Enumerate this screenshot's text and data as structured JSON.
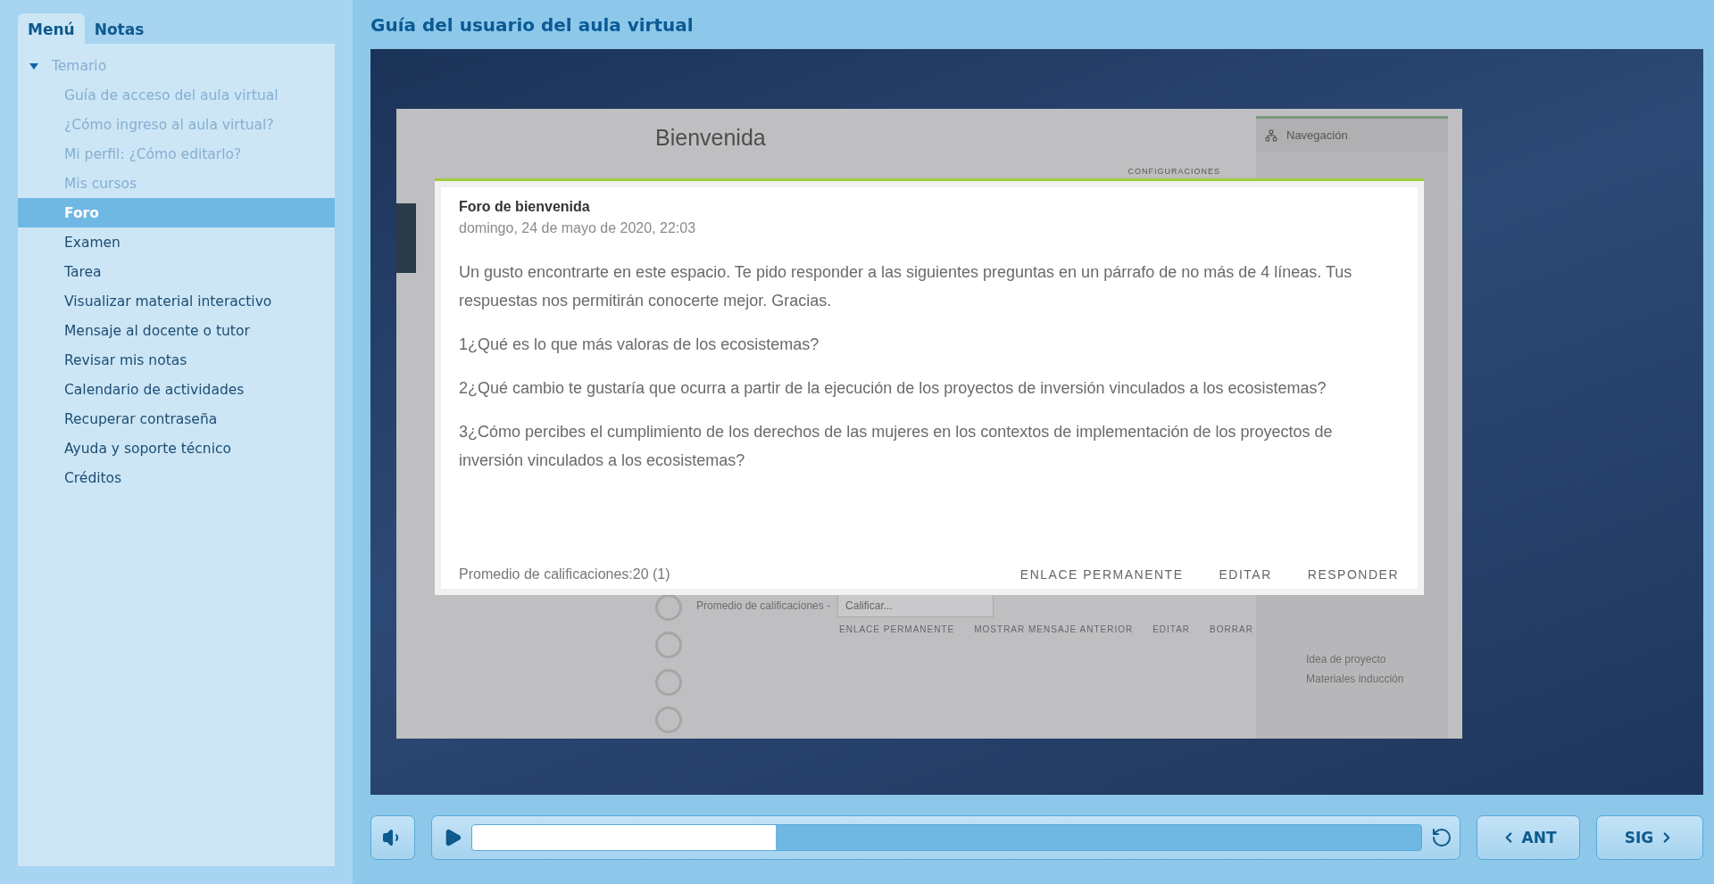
{
  "sidebar": {
    "tabs": [
      {
        "label": "Menú",
        "selected": true
      },
      {
        "label": "Notas",
        "selected": false
      }
    ],
    "tree": {
      "label": "Temario",
      "expanded": true,
      "children": [
        {
          "label": "Guía de acceso del aula virtual",
          "visited": true,
          "selected": false
        },
        {
          "label": "¿Cómo ingreso al aula virtual?",
          "visited": true,
          "selected": false
        },
        {
          "label": "Mi perfil: ¿Cómo editarlo?",
          "visited": true,
          "selected": false
        },
        {
          "label": "Mis cursos",
          "visited": true,
          "selected": false
        },
        {
          "label": "Foro",
          "visited": false,
          "selected": true
        },
        {
          "label": "Examen",
          "visited": false,
          "selected": false
        },
        {
          "label": "Tarea",
          "visited": false,
          "selected": false
        },
        {
          "label": "Visualizar material interactivo",
          "visited": false,
          "selected": false
        },
        {
          "label": "Mensaje al docente o tutor",
          "visited": false,
          "selected": false
        },
        {
          "label": "Revisar mis notas",
          "visited": false,
          "selected": false
        },
        {
          "label": "Calendario de actividades",
          "visited": false,
          "selected": false
        },
        {
          "label": "Recuperar contraseña",
          "visited": false,
          "selected": false
        },
        {
          "label": "Ayuda y soporte técnico",
          "visited": false,
          "selected": false
        },
        {
          "label": "Créditos",
          "visited": false,
          "selected": false
        }
      ]
    }
  },
  "player": {
    "title": "Guía del usuario del aula virtual",
    "slide": {
      "page": {
        "heading": "Bienvenida",
        "settings": "CONFIGURACIONES",
        "grade_label": "Promedio de calificaciones -",
        "grade_select": "Calificar...",
        "actions": [
          "ENLACE PERMANENTE",
          "MOSTRAR MENSAJE ANTERIOR",
          "EDITAR",
          "BORRAR"
        ],
        "navigation": {
          "title": "Navegación",
          "links": [
            "Idea de proyecto",
            "Materiales inducción"
          ]
        }
      },
      "dialog": {
        "title": "Foro de bienvenida",
        "date": "domingo, 24 de mayo de 2020, 22:03",
        "paragraphs": [
          "Un gusto encontrarte en este espacio. Te pido responder a las siguientes preguntas en un párrafo de no más de 4 líneas. Tus respuestas nos permitirán conocerte mejor. Gracias.",
          "1¿Qué es lo que más valoras de los ecosistemas?",
          "2¿Qué cambio te gustaría que ocurra a partir de la ejecución de los proyectos de inversión vinculados a los ecosistemas?",
          "3¿Cómo percibes el cumplimiento de los derechos de las mujeres en los contextos de implementación de los proyectos de inversión vinculados a los ecosistemas?"
        ],
        "rating": "Promedio de calificaciones:20 (1)",
        "actions": [
          "ENLACE PERMANENTE",
          "EDITAR",
          "RESPONDER"
        ]
      }
    },
    "controls": {
      "progress": {
        "level": 0.32
      },
      "prev": "ANT",
      "next": "SIG"
    }
  }
}
